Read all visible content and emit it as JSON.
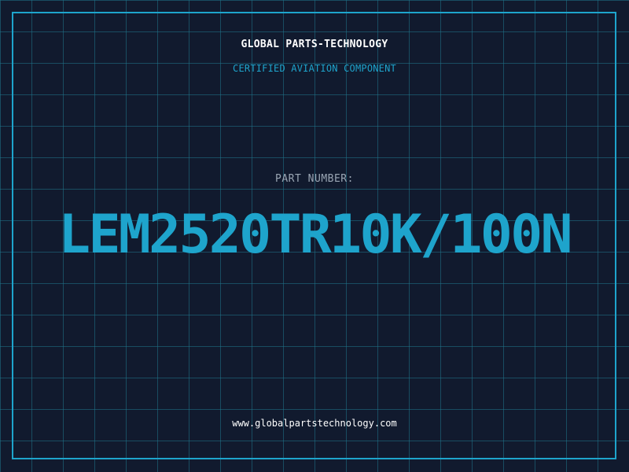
{
  "header": {
    "brand": "GLOBAL PARTS-TECHNOLOGY",
    "tagline": "CERTIFIED AVIATION COMPONENT"
  },
  "part": {
    "label": "PART NUMBER:",
    "number": "LEM2520TR10K/100N"
  },
  "footer": {
    "url": "www.globalpartstechnology.com"
  },
  "colors": {
    "background": "#111a2e",
    "grid": "#1f748a",
    "accent": "#1ea4cc",
    "label": "#9aa6b4",
    "text": "#ffffff"
  }
}
